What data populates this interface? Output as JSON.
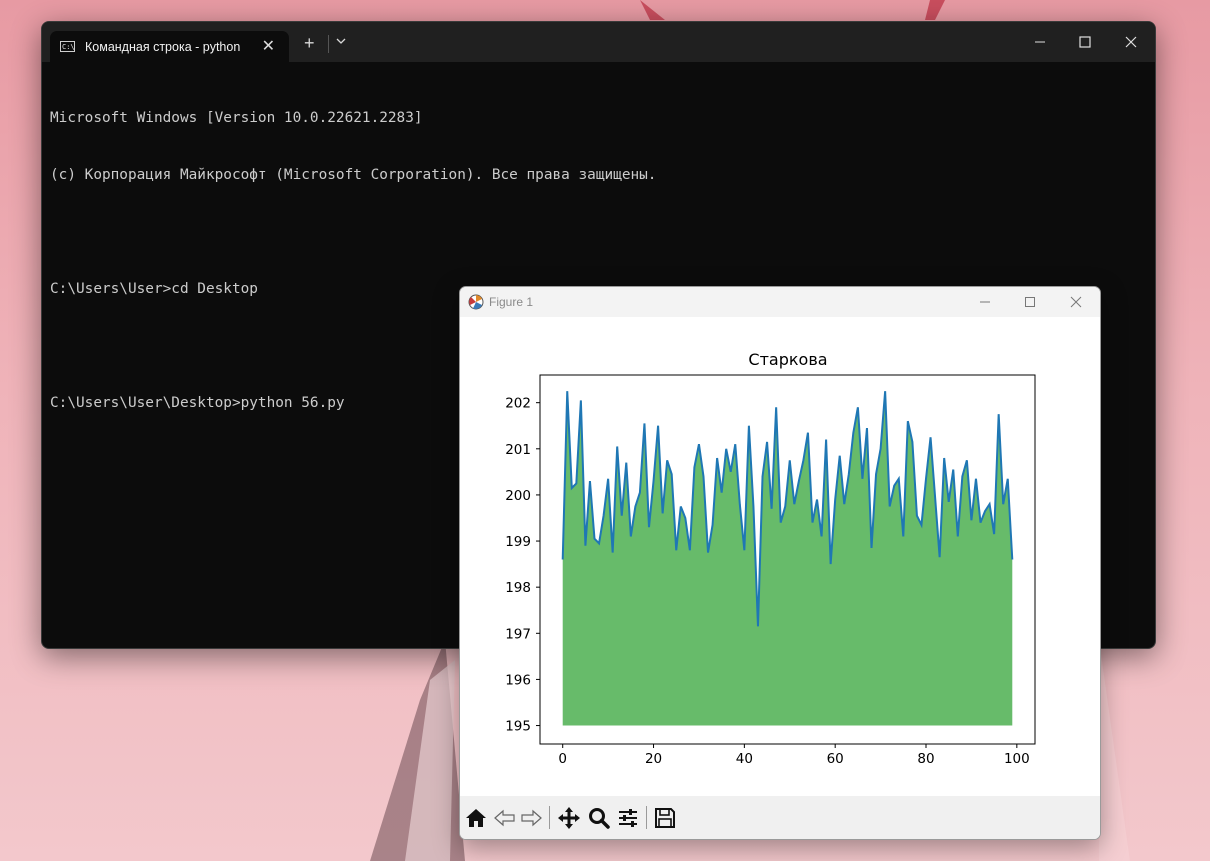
{
  "terminal": {
    "tab_title": "Командная строка - python",
    "tab_icon_text": "C:\\",
    "new_tab_glyph": "+",
    "close_tab_glyph": "✕",
    "lines": [
      "Microsoft Windows [Version 10.0.22621.2283]",
      "(c) Корпорация Майкрософт (Microsoft Corporation). Все права защищены.",
      "",
      "C:\\Users\\User>cd Desktop",
      "",
      "C:\\Users\\User\\Desktop>python 56.py"
    ]
  },
  "figure": {
    "window_title": "Figure 1",
    "toolbar": [
      {
        "name": "home-icon",
        "label": "Home"
      },
      {
        "name": "back-arrow-icon",
        "label": "Back"
      },
      {
        "name": "forward-arrow-icon",
        "label": "Forward"
      },
      {
        "name": "pan-move-icon",
        "label": "Pan"
      },
      {
        "name": "zoom-magnifier-icon",
        "label": "Zoom"
      },
      {
        "name": "configure-subplots-icon",
        "label": "Subplots"
      },
      {
        "name": "save-floppy-icon",
        "label": "Save"
      }
    ]
  },
  "colors": {
    "terminal_bg": "#0c0c0c",
    "terminal_text": "#cccccc",
    "line": "#1f77b4",
    "fill": "#4caf50",
    "fill_opacity": 0.85
  },
  "chart_data": {
    "type": "area",
    "title": "Старкова",
    "xlabel": "",
    "ylabel": "",
    "xlim": [
      -5,
      104
    ],
    "ylim": [
      194.6,
      202.6
    ],
    "xticks": [
      0,
      20,
      40,
      60,
      80,
      100
    ],
    "yticks": [
      195,
      196,
      197,
      198,
      199,
      200,
      201,
      202
    ],
    "fill_baseline": 195,
    "grid": false,
    "x": [
      0,
      1,
      2,
      3,
      4,
      5,
      6,
      7,
      8,
      9,
      10,
      11,
      12,
      13,
      14,
      15,
      16,
      17,
      18,
      19,
      20,
      21,
      22,
      23,
      24,
      25,
      26,
      27,
      28,
      29,
      30,
      31,
      32,
      33,
      34,
      35,
      36,
      37,
      38,
      39,
      40,
      41,
      42,
      43,
      44,
      45,
      46,
      47,
      48,
      49,
      50,
      51,
      52,
      53,
      54,
      55,
      56,
      57,
      58,
      59,
      60,
      61,
      62,
      63,
      64,
      65,
      66,
      67,
      68,
      69,
      70,
      71,
      72,
      73,
      74,
      75,
      76,
      77,
      78,
      79,
      80,
      81,
      82,
      83,
      84,
      85,
      86,
      87,
      88,
      89,
      90,
      91,
      92,
      93,
      94,
      95,
      96,
      97,
      98,
      99
    ],
    "y": [
      198.6,
      202.25,
      200.15,
      200.25,
      202.05,
      198.9,
      200.3,
      199.05,
      198.95,
      199.55,
      200.35,
      198.75,
      201.05,
      199.55,
      200.7,
      199.1,
      199.75,
      200.05,
      201.55,
      199.3,
      200.3,
      201.5,
      199.6,
      200.75,
      200.45,
      198.8,
      199.75,
      199.5,
      198.8,
      200.6,
      201.1,
      200.4,
      198.75,
      199.35,
      200.8,
      200.05,
      201.0,
      200.5,
      201.1,
      199.8,
      198.8,
      201.5,
      199.75,
      197.15,
      200.4,
      201.15,
      199.7,
      201.9,
      199.4,
      199.75,
      200.75,
      199.8,
      200.3,
      200.75,
      201.35,
      199.4,
      199.9,
      199.1,
      201.2,
      198.5,
      199.9,
      200.85,
      199.8,
      200.45,
      201.35,
      201.9,
      200.35,
      201.45,
      198.85,
      200.45,
      201.0,
      202.25,
      199.75,
      200.2,
      200.35,
      199.1,
      201.6,
      201.15,
      199.55,
      199.35,
      200.35,
      201.25,
      199.95,
      198.65,
      200.8,
      199.85,
      200.55,
      199.1,
      200.4,
      200.75,
      199.45,
      200.35,
      199.4,
      199.65,
      199.8,
      199.15,
      201.75,
      199.8,
      200.35,
      198.6
    ]
  }
}
